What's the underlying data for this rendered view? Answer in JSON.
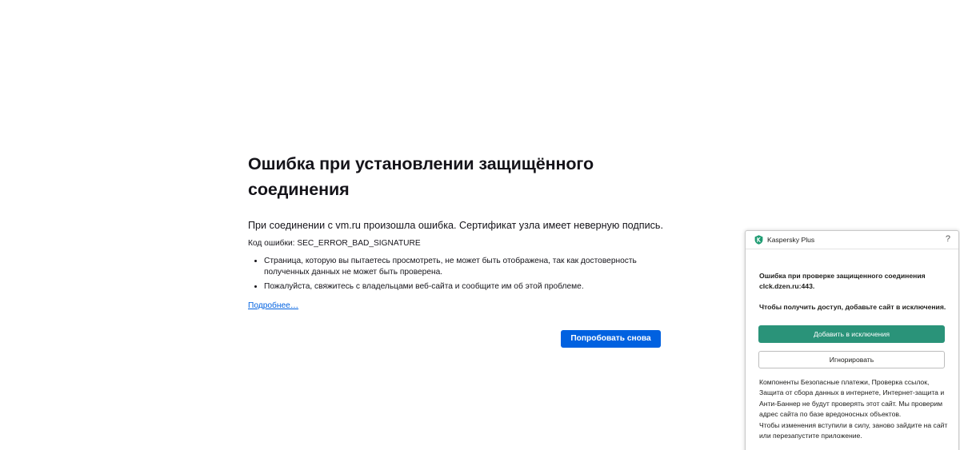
{
  "error_page": {
    "title": "Ошибка при установлении защищённого соединения",
    "summary": "При соединении с vm.ru произошла ошибка. Сертификат узла имеет неверную подпись.",
    "error_code": "Код ошибки: SEC_ERROR_BAD_SIGNATURE",
    "details": [
      "Страница, которую вы пытаетесь просмотреть, не может быть отображена, так как достоверность полученных данных не может быть проверена.",
      "Пожалуйста, свяжитесь с владельцами веб-сайта и сообщите им об этой проблеме."
    ],
    "learn_more_label": "Подробнее…",
    "try_again_label": "Попробовать снова"
  },
  "kaspersky": {
    "app_name": "Kaspersky Plus",
    "help_icon": "question-mark-icon",
    "logo_icon": "kaspersky-shield-icon",
    "heading": "Ошибка при проверке защищенного соединения clck.dzen.ru:443.",
    "instruction": "Чтобы получить доступ, добавьте сайт в исключения.",
    "add_exception_label": "Добавить в исключения",
    "ignore_label": "Игнорировать",
    "notes": [
      "Компоненты Безопасные платежи, Проверка ссылок, Защита от сбора данных в интернете, Интернет-защита и Анти-Баннер не будут проверять этот сайт. Мы проверим адрес сайта по базе вредоносных объектов.",
      "Чтобы изменения вступили в силу, заново зайдите на сайт или перезапустите приложение."
    ]
  },
  "colors": {
    "primary_button": "#0061e0",
    "link": "#0061e0",
    "kaspersky_accent": "#2a9379",
    "text": "#15141a"
  }
}
